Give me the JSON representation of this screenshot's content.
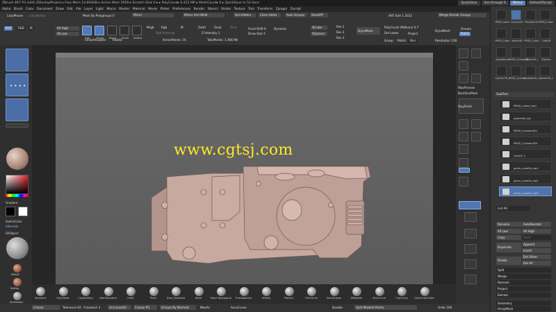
{
  "titlebar": {
    "text": "ZBrush 4R7 P3 (x64)     ZStartupProject     ▸ Free Mem 14.693GB ▸ Active Mem 2959 ▸ Scratch Disk 0 ▸ ▸ PolyCount▸ 6.422 MP ▸ MeshCount▸ 6 ▸ QuickSave In 53 Secs",
    "quicksave": "QuickSave",
    "seethrough": "See-through  0",
    "menus": "Menus",
    "script": "DefaultZScript"
  },
  "menubar": [
    "Alpha",
    "Brush",
    "Color",
    "Document",
    "Draw",
    "Edit",
    "File",
    "Layer",
    "Light",
    "Macro",
    "Marker",
    "Material",
    "Movie",
    "Picker",
    "Preferences",
    "Render",
    "Stencil",
    "Stroke",
    "Texture",
    "Tool",
    "Transform",
    "Zplugin",
    "Zscript"
  ],
  "toptools": {
    "lazymouse": "LazyMouse",
    "lazyradius": "LazyRadius",
    "mask_by_polygroups": "Mask By Polygroups 0",
    "mirror": "Mirror",
    "mirror_weld": "Mirror And Weld",
    "del_hidden": "Del Hidden",
    "close_holes": "Close Holes",
    "auto_groups": "Auto Groups",
    "store_mt": "StoreMT",
    "rgb_mode": "RGB",
    "m_mode": "M",
    "xyz": "XYZ",
    "all_high": "All High",
    "all_low": "All Low",
    "edit": "Edit",
    "draw": "Draw",
    "move": "Move",
    "scale": "Scale",
    "rotate": "Rotate",
    "mrgb": "Mrgb",
    "rgb": "Rgb",
    "m": "M",
    "zadd": "Zadd",
    "zsub": "Zsub",
    "zcut": "Zcut",
    "rgb_intensity": "Rgb Intensity",
    "z_intensity": "Z Intensity 1",
    "focal_shift": "Focal Shift 0",
    "draw_size": "Draw Size 5",
    "dynamic": "Dynamic",
    "smooth_subdiv": "SmoothSubdiv",
    "rotate_label": "Rotate",
    "active_points": "ActivePoints: 16",
    "total_points": "TotalPoints: 1.466 Mil",
    "qcube": "QCube",
    "qsphere": "QSphere",
    "res1": "Res 1",
    "res2": "Res 2",
    "res3": "Res 3",
    "dynamesh": "DynaMesh",
    "polycount": "PolyCount (Millions) 0.7",
    "del_lower": "Del Lower",
    "project": "Project",
    "group": "Group",
    "polish": "Polish",
    "groups": "Groups",
    "blur": "Blur",
    "resolution": "Resolution 128",
    "merge_similar": "Merge Similar Groups",
    "dynamesh_r": "DynaMesh",
    "edit_btn": "Edit",
    "visible": "Visible",
    "dvc_size": "dVE Size 1.3222"
  },
  "leftshelf": {
    "gradient": "Gradient",
    "switchcolor": "SwitchColor",
    "alternate": "Alternate",
    "fillobject": "FillObject",
    "mat1": "Default",
    "mat2": "MatCap",
    "mat3": "SkinShade4"
  },
  "rightshelf": {
    "waxpreview": "WaxPreview",
    "backfacemask": "BackfaceMask",
    "stay_polish": "StayPolish",
    "floor": "Floor",
    "local": "Local",
    "xyz": "Xyz",
    "polyf": "PolyF",
    "transp": "Transp",
    "ghost": "Ghost"
  },
  "rightpanel": {
    "subtool": "SubTool",
    "tools": [
      "PM3D_cubeU",
      "Cylinder3D",
      "PolyMesh3D",
      "PM3D_Cube1",
      "PM3D_Cube2",
      "Sphere3D",
      "PM3D_Cube3",
      "Cube3D",
      "SimpleBrush",
      "PM3D_Cylinder3D",
      "Sphere3D_1",
      "ZSphere",
      "Cylinder3D_1",
      "PM3D_Cylinder",
      "PolyMesh3D_1",
      "Sphere3D_2"
    ],
    "subtools": [
      "PM3D_cube4_rep1",
      "paperball_sq1",
      "PM3D_Cylinder3D1",
      "PM3D_Cylinder3D4",
      "Lazuli5_1",
      "gerim_cube3d_rep1",
      "gerim_cube3d_rep2",
      "gerim_cube3d_rep3"
    ],
    "list_all": "List All",
    "rename": "Rename",
    "autoreorder": "AutoReorder",
    "all_low": "All Low",
    "all_high": "All High",
    "copy": "Copy",
    "paste": "Paste",
    "duplicate": "Duplicate",
    "append": "Append",
    "insert": "Insert",
    "delete": "Delete",
    "del_other": "Del Other",
    "del_all": "Del All",
    "split": "Split",
    "merge": "Merge",
    "remesh": "Remesh",
    "project": "Project",
    "extract": "Extract",
    "geometry": "Geometry",
    "arraymesh": "ArrayMesh"
  },
  "brushes": [
    "Standard",
    "ClayTubes",
    "ClayBuildup",
    "DamStandard",
    "Inflat",
    "Pinch",
    "Dam_Standard",
    "Move",
    "Move Topological",
    "TrimAdaptive",
    "hPolish",
    "Planar2",
    "TrimCurve",
    "SelectLasso",
    "ZModeler",
    "SliceCurve",
    "ClipCurve",
    "ClipCircleCenter"
  ],
  "bottombar": {
    "crease": "Crease",
    "tolerance": "Tolerance 62",
    "crease_level": "CreaseLvl 3",
    "uncrease_all": "UncreaseAll",
    "crease_pg": "Crease PG",
    "groups_by_normals": "Groups By Normals",
    "maxangle": "MaxAn",
    "accucurve": "AccuCurve",
    "double": "Double",
    "split_masked": "Split Masked Points",
    "undo": "Undo 100"
  },
  "watermark": "www.cgtsj.com",
  "colors": {
    "accent": "#5b85c2",
    "model": "#c8a9a0",
    "canvas": "#666666",
    "watermark": "#ffe82a"
  }
}
